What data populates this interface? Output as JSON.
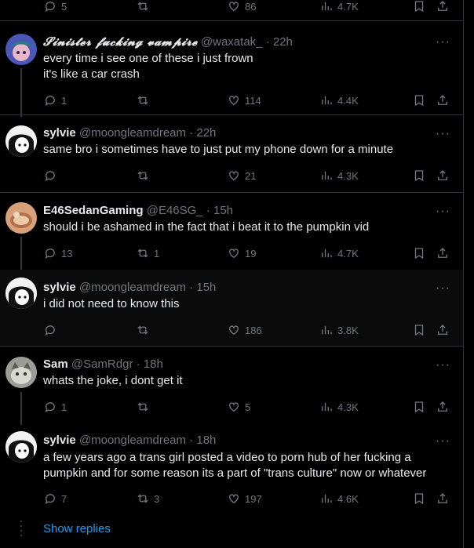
{
  "top_actions": {
    "replies": "5",
    "reposts": "",
    "likes": "86",
    "views": "4.7K"
  },
  "tweets": [
    {
      "name": "𝓢𝓲𝓷𝓲𝓼𝓽𝓮𝓻 𝓯𝓾𝓬𝓴𝓲𝓷𝓰 𝓿𝓪𝓶𝓹𝓲𝓻𝓮",
      "handle": "@waxatak_",
      "time": "22h",
      "text": "every time i see one of these i just frown\nit's like a car crash",
      "replies": "1",
      "reposts": "",
      "likes": "114",
      "views": "4.4K"
    },
    {
      "name": "sylvie",
      "handle": "@moongleamdream",
      "time": "22h",
      "text": "same bro i sometimes have to just put my phone down for a minute",
      "replies": "",
      "reposts": "",
      "likes": "21",
      "views": "4.3K"
    },
    {
      "name": "E46SedanGaming",
      "handle": "@E46SG_",
      "time": "15h",
      "text": "should i be ashamed in the fact that i beat it to the pumpkin vid",
      "replies": "13",
      "reposts": "1",
      "likes": "19",
      "views": "4.7K"
    },
    {
      "name": "sylvie",
      "handle": "@moongleamdream",
      "time": "15h",
      "text": "i did not need to know this",
      "replies": "",
      "reposts": "",
      "likes": "186",
      "views": "3.8K"
    },
    {
      "name": "Sam",
      "handle": "@SamRdgr",
      "time": "18h",
      "text": "whats the joke, i dont get it",
      "replies": "1",
      "reposts": "",
      "likes": "5",
      "views": "4.3K"
    },
    {
      "name": "sylvie",
      "handle": "@moongleamdream",
      "time": "18h",
      "text": "a few years ago a trans girl posted a video to porn hub of her fucking a pumpkin and for some reason its a part of \"trans culture\" now or whatever",
      "replies": "7",
      "reposts": "3",
      "likes": "197",
      "views": "4.6K"
    }
  ],
  "dot": "·",
  "more": "···",
  "show_replies": "Show replies",
  "colors": {
    "background": "#000000",
    "text": "#e7e9ea",
    "muted": "#71767b",
    "link": "#1d9bf0",
    "border": "#2f3336"
  },
  "icons": [
    "reply-icon",
    "repost-icon",
    "like-icon",
    "views-icon",
    "bookmark-icon",
    "share-icon",
    "more-icon"
  ]
}
